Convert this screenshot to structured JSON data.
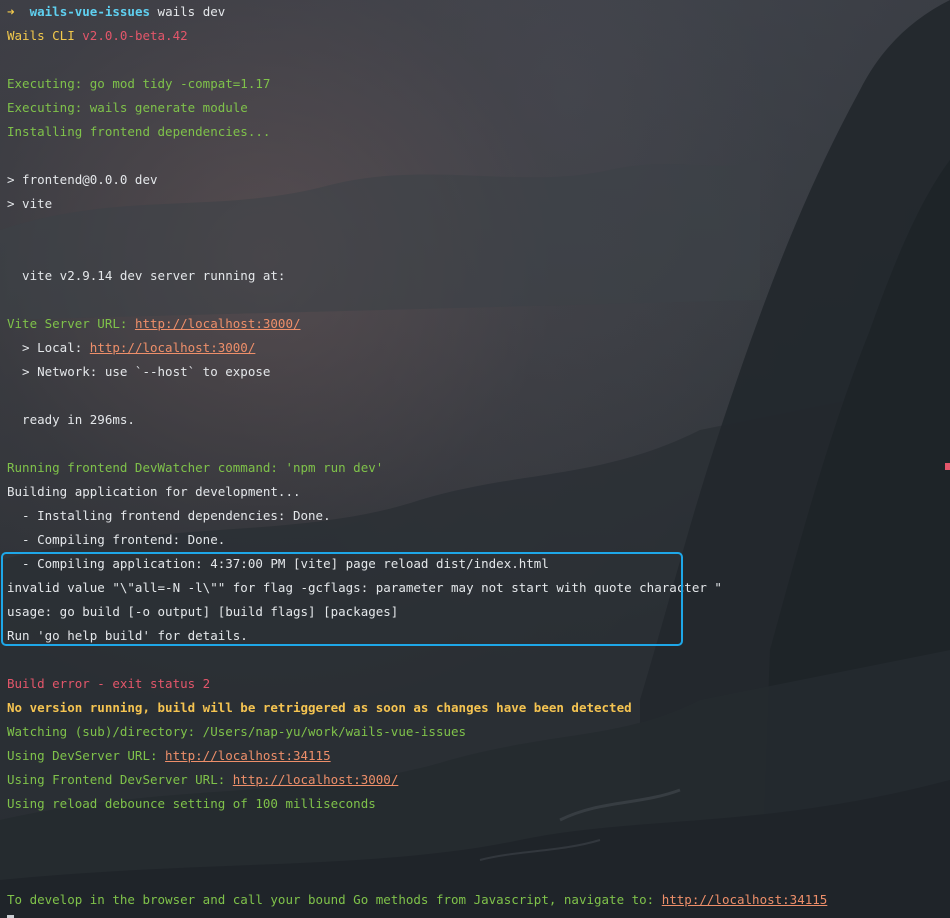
{
  "prompt": {
    "arrow": "➜",
    "directory": "wails-vue-issues",
    "command": "wails dev"
  },
  "lines": {
    "cli_label": "Wails CLI",
    "cli_version": "v2.0.0-beta.42",
    "exec_tidy": "Executing: go mod tidy -compat=1.17",
    "exec_generate": "Executing: wails generate module",
    "installing_deps": "Installing frontend dependencies...",
    "npm_script": "> frontend@0.0.0 dev",
    "npm_vite": "> vite",
    "vite_running": "  vite v2.9.14 dev server running at:",
    "vite_server_label": "Vite Server URL: ",
    "vite_server_url": "http://localhost:3000/",
    "local_label": "  > Local: ",
    "local_url": "http://localhost:3000/",
    "network": "  > Network: use `--host` to expose",
    "ready": "  ready in 296ms.",
    "devwatcher": "Running frontend DevWatcher command: 'npm run dev'",
    "building": "Building application for development...",
    "step_install": "  - Installing frontend dependencies: Done.",
    "step_compile_frontend": "  - Compiling frontend: Done.",
    "step_compile_app": "  - Compiling application: 4:37:00 PM [vite] page reload dist/index.html",
    "invalid_value": "invalid value \"\\\"all=-N -l\\\"\" for flag -gcflags: parameter may not start with quote character \"",
    "usage": "usage: go build [-o output] [build flags] [packages]",
    "run_help": "Run 'go help build' for details.",
    "build_error": "Build error - exit status 2",
    "no_version": "No version running, build will be retriggered as soon as changes have been detected",
    "watching": "Watching (sub)/directory: /Users/nap-yu/work/wails-vue-issues",
    "devserver_label": "Using DevServer URL: ",
    "devserver_url": "http://localhost:34115",
    "frontend_devserver_label": "Using Frontend DevServer URL: ",
    "frontend_devserver_url": "http://localhost:3000/",
    "debounce": "Using reload debounce setting of 100 milliseconds",
    "browser_hint": "To develop in the browser and call your bound Go methods from Javascript, navigate to: ",
    "browser_url": "http://localhost:34115"
  },
  "colors": {
    "info_green": "#7fc24a",
    "prompt_cyan": "#5fd0f0",
    "warning_yellow": "#f5c451",
    "error_red": "#e3566a",
    "link_orange": "#ee8f6a",
    "highlight_blue": "#1ea7e8"
  }
}
